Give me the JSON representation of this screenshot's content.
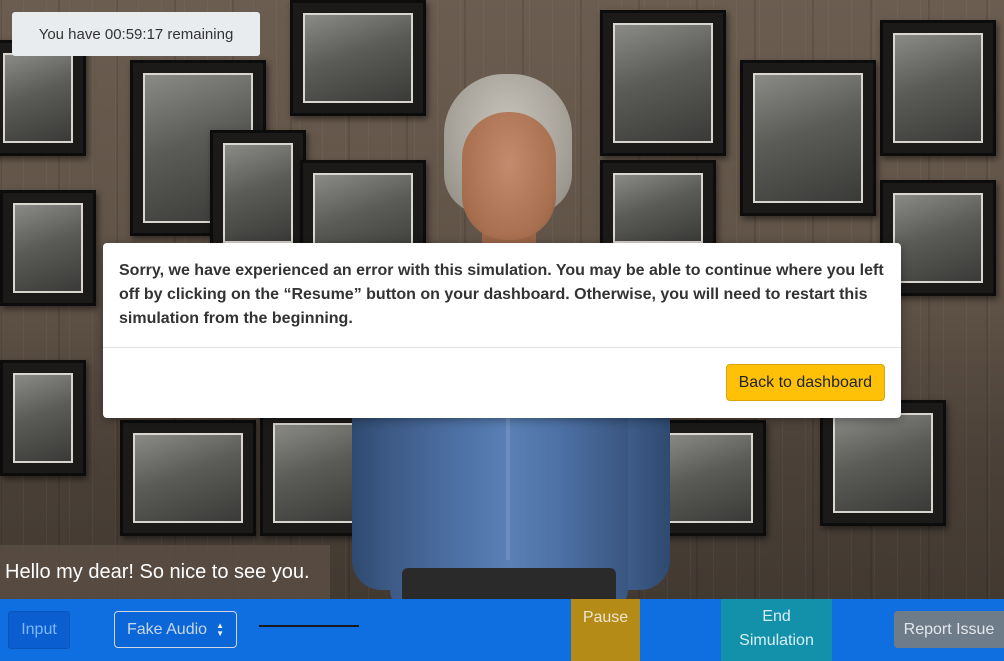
{
  "timer": {
    "text": "You have 00:59:17 remaining"
  },
  "modal": {
    "message": "Sorry, we have experienced an error with this simulation. You may be able to continue where you left off by clicking on the “Resume” button on your dashboard. Otherwise, you will need to restart this simulation from the beginning.",
    "button_label": "Back to dashboard"
  },
  "speech": {
    "text": "Hello my dear! So nice to see you."
  },
  "controls": {
    "input_label": "Input",
    "audio_selected": "Fake Audio",
    "pause_label": "Pause",
    "end_label_line1": "End",
    "end_label_line2": "Simulation",
    "report_label": "Report Issue"
  },
  "colors": {
    "control_bar": "#0f6fe0",
    "pause": "#b48b16",
    "end": "#1391ab",
    "report": "#6e7c8a",
    "modal_button": "#ffc107"
  }
}
